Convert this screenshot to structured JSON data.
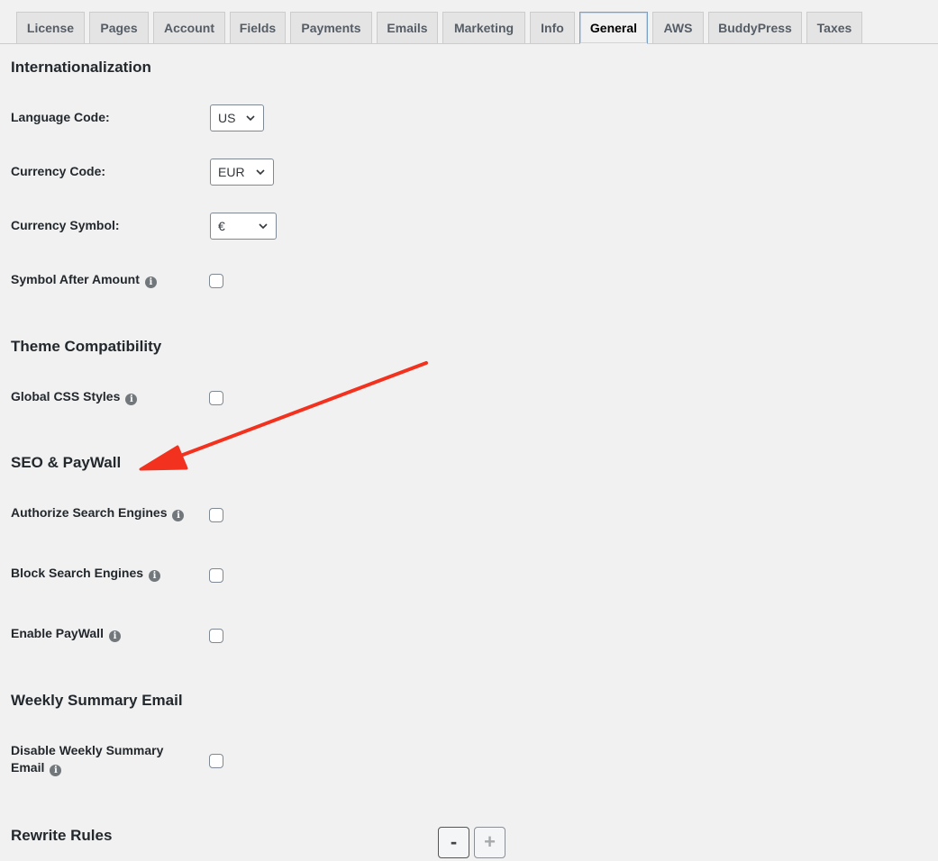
{
  "tabs": [
    {
      "label": "License"
    },
    {
      "label": "Pages"
    },
    {
      "label": "Account"
    },
    {
      "label": "Fields"
    },
    {
      "label": "Payments"
    },
    {
      "label": "Emails"
    },
    {
      "label": "Marketing"
    },
    {
      "label": "Info"
    },
    {
      "label": "General",
      "active": true
    },
    {
      "label": "AWS"
    },
    {
      "label": "BuddyPress"
    },
    {
      "label": "Taxes"
    }
  ],
  "sections": {
    "internationalization": {
      "title": "Internationalization",
      "language_code": {
        "label": "Language Code:",
        "value": "US"
      },
      "currency_code": {
        "label": "Currency Code:",
        "value": "EUR"
      },
      "currency_symbol": {
        "label": "Currency Symbol:",
        "value": "€"
      },
      "symbol_after_amount": {
        "label": "Symbol After Amount",
        "checked": false
      }
    },
    "theme": {
      "title": "Theme Compatibility",
      "global_css": {
        "label": "Global CSS Styles",
        "checked": false
      }
    },
    "seo": {
      "title": "SEO & PayWall",
      "authorize_search": {
        "label": "Authorize Search Engines",
        "checked": false
      },
      "block_search": {
        "label": "Block Search Engines",
        "checked": false
      },
      "enable_paywall": {
        "label": "Enable PayWall",
        "checked": false
      }
    },
    "weekly": {
      "title": "Weekly Summary Email",
      "disable_line1": "Disable Weekly Summary",
      "disable_line2": "Email",
      "checked": false
    },
    "rewrite": {
      "title": "Rewrite Rules",
      "minus": "-",
      "plus": "+"
    }
  },
  "icons": {
    "info": "info-icon",
    "chevron": "chevron-down-icon"
  },
  "colors": {
    "annotation_arrow": "#f2321f",
    "active_tab_border": "#7ba0c7"
  }
}
